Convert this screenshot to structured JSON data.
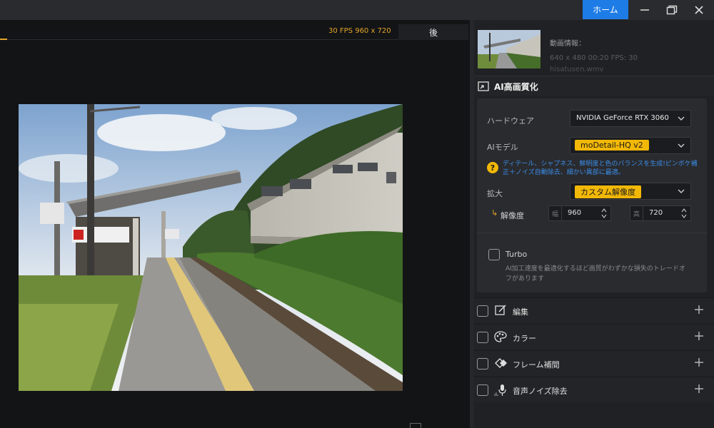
{
  "window": {
    "home_label": "ホーム",
    "minimize_icon": "minimize-icon",
    "maximize_icon": "maximize-icon",
    "close_icon": "close-icon"
  },
  "preview": {
    "fps_resolution": "30 FPS  960 x 720",
    "after_tab": "後"
  },
  "video_info": {
    "title": "動画情報：",
    "specs": "640 x 480  00:20    FPS: 30",
    "filename": "hisatusen.wmv"
  },
  "ai_section": {
    "title": "AI高画質化",
    "hardware_label": "ハードウェア",
    "hardware_value": "NVIDIA GeForce RTX 3060",
    "model_label": "AIモデル",
    "model_value": "moDetail-HQ  v2",
    "model_help": "ディテール、シャプネス、鮮明度と色のバランスを生成!ピンボケ補正＋ノイズ自動除去、細かい異部に最適。",
    "scale_label": "拡大",
    "scale_value": "カスタム解像度",
    "resolution_label": "解像度",
    "width_prefix": "幅",
    "width_value": "960",
    "height_prefix": "高",
    "height_value": "720",
    "turbo_label": "Turbo",
    "turbo_desc": "AI加工速度を最適化するほど画質がわずかな損失のトレードオフがあります"
  },
  "accordion": [
    {
      "label": "編集",
      "icon": "edit-icon"
    },
    {
      "label": "カラー",
      "icon": "palette-icon"
    },
    {
      "label": "フレーム補間",
      "icon": "frame-interpolation-icon"
    },
    {
      "label": "音声ノイズ除去",
      "icon": "microphone-icon"
    }
  ],
  "colors": {
    "accent": "#1e7ce6",
    "highlight": "#f2b807",
    "fps_text": "#e3a52a",
    "help_text": "#3a8ee8"
  }
}
